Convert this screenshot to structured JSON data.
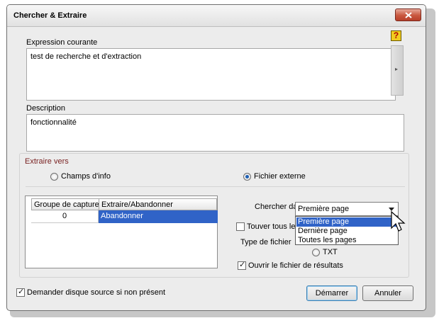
{
  "window": {
    "title": "Chercher & Extraire"
  },
  "expression": {
    "label": "Expression courante",
    "value": "test de recherche et d'extraction"
  },
  "description": {
    "label": "Description",
    "value": "fonctionnalité"
  },
  "extract": {
    "group_title": "Extraire vers",
    "radio_info": "Champs d'info",
    "radio_file": "Fichier externe"
  },
  "table": {
    "headers": [
      "Groupe de capture",
      "Extraire/Abandonner"
    ],
    "rows": [
      {
        "group": "0",
        "action": "Abandonner"
      }
    ]
  },
  "search_in": {
    "label": "Chercher da",
    "selected": "Première page",
    "options": [
      "Première page",
      "Dernière page",
      "Toutes les pages"
    ]
  },
  "find_all": {
    "label": "Touver tous le",
    "checked": false
  },
  "file_type": {
    "label": "Type de fichier",
    "txt_label": "TXT"
  },
  "open_results": {
    "label": "Ouvrir le fichier de résultats",
    "checked": true
  },
  "ask_source": {
    "label": "Demander disque source si non présent",
    "checked": true
  },
  "buttons": {
    "start": "Démarrer",
    "cancel": "Annuler"
  },
  "help_icon": {
    "glyph": "?"
  },
  "colors": {
    "selection": "#3063c7",
    "group_title": "#7a2323"
  }
}
